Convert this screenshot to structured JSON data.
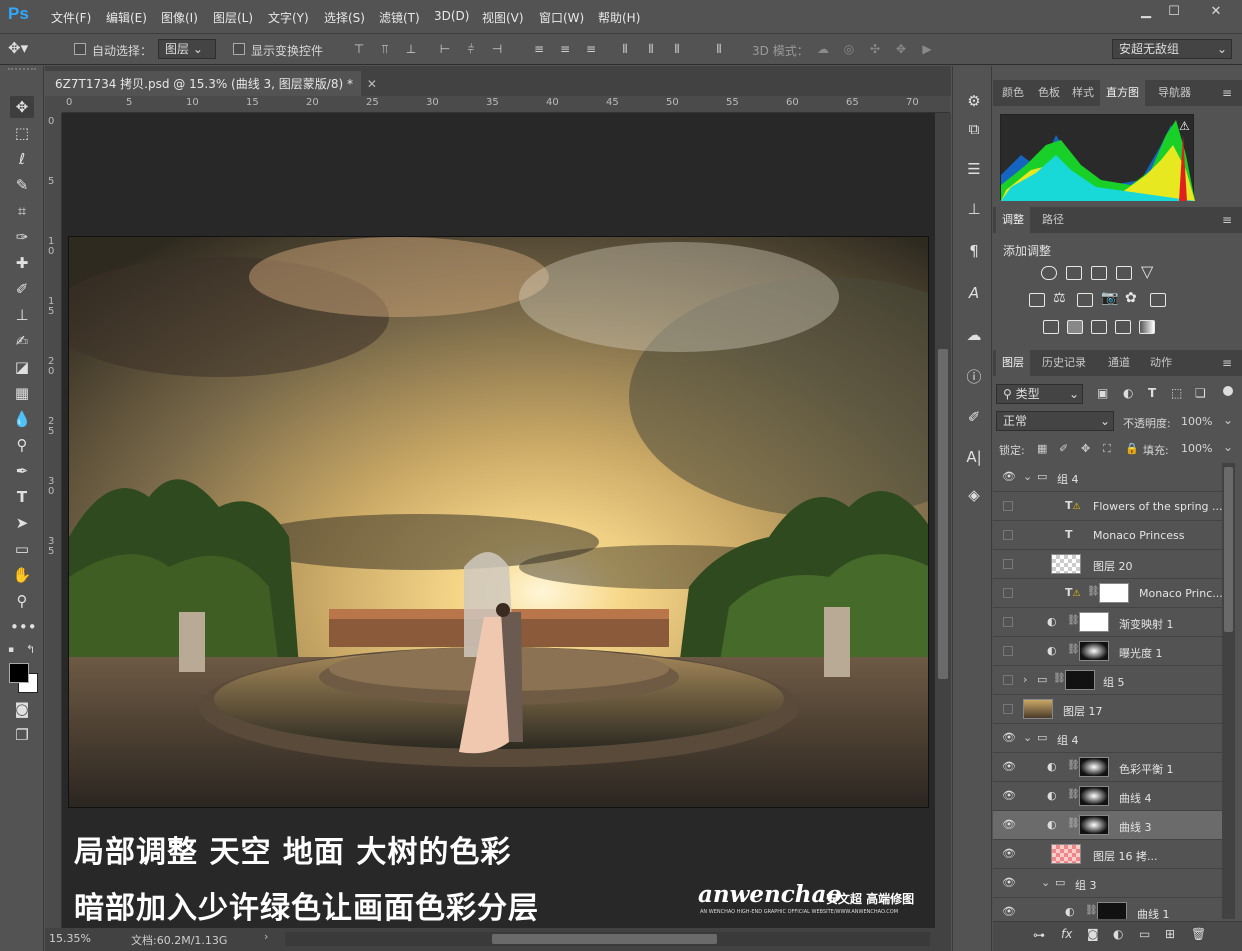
{
  "app": {
    "logo": "Ps"
  },
  "menu": [
    "文件(F)",
    "编辑(E)",
    "图像(I)",
    "图层(L)",
    "文字(Y)",
    "选择(S)",
    "滤镜(T)",
    "3D(D)",
    "视图(V)",
    "窗口(W)",
    "帮助(H)"
  ],
  "window_buttons": {
    "minimize": "▁",
    "restore": "☐",
    "close": "✕"
  },
  "options": {
    "auto_select_label": "自动选择：",
    "auto_select_value": "图层",
    "show_transform_label": "显示变换控件",
    "mode_3d_label": "3D 模式：",
    "workspace": "安超无敌组"
  },
  "document": {
    "tab_title": "6Z7T1734 拷贝.psd @ 15.3% (曲线 3, 图层蒙版/8) *",
    "ruler_h": [
      "0",
      "5",
      "10",
      "15",
      "20",
      "25",
      "30",
      "35",
      "40",
      "45",
      "50",
      "55",
      "60",
      "65",
      "70"
    ],
    "ruler_v": [
      "0",
      "5",
      "10",
      "15",
      "20",
      "25",
      "30",
      "35"
    ],
    "caption_line1": "局部调整  天空  地面  大树的色彩",
    "caption_line2": "暗部加入少许绿色让画面色彩分层",
    "watermark_main": "anwenchao",
    "watermark_cn": "安文超 高端修图",
    "watermark_sub": "AN WENCHAO HIGH-END GRAPHIC OFFICIAL WEBSITE/WWW.ANWENCHAO.COM"
  },
  "status": {
    "zoom": "15.35%",
    "doc_size": "文档:60.2M/1.13G"
  },
  "panels": {
    "top_tabs": [
      "颜色",
      "色板",
      "样式",
      "直方图",
      "导航器"
    ],
    "top_active": "直方图",
    "adj_tabs": [
      "调整",
      "路径"
    ],
    "adj_title": "添加调整",
    "layers_tabs": [
      "图层",
      "历史记录",
      "通道",
      "动作"
    ],
    "filter_kind": "类型",
    "blend_mode": "正常",
    "opacity_label": "不透明度:",
    "opacity_value": "100%",
    "lock_label": "锁定:",
    "fill_label": "填充:",
    "fill_value": "100%"
  },
  "layers": [
    {
      "name": "组 4",
      "type": "group",
      "visible": true,
      "indent": 0
    },
    {
      "name": "Flowers of the spring ...",
      "type": "text-warn",
      "visible": false,
      "indent": 1
    },
    {
      "name": "Monaco Princess",
      "type": "text",
      "visible": false,
      "indent": 1
    },
    {
      "name": "图层 20",
      "type": "checker",
      "visible": false,
      "indent": 1
    },
    {
      "name": "Monaco Princ...",
      "type": "text-mask",
      "visible": false,
      "indent": 1
    },
    {
      "name": "渐变映射 1",
      "type": "adj-white",
      "visible": false,
      "indent": 1
    },
    {
      "name": "曝光度 1",
      "type": "adj-mask",
      "visible": false,
      "indent": 1
    },
    {
      "name": "组 5",
      "type": "group-closed",
      "visible": false,
      "indent": 0
    },
    {
      "name": "图层 17",
      "type": "photo",
      "visible": false,
      "indent": 0
    },
    {
      "name": "组 4",
      "type": "group",
      "visible": true,
      "indent": 0
    },
    {
      "name": "色彩平衡 1",
      "type": "adj-mask",
      "visible": true,
      "indent": 1
    },
    {
      "name": "曲线 4",
      "type": "adj-mask",
      "visible": true,
      "indent": 1
    },
    {
      "name": "曲线 3",
      "type": "adj-mask",
      "visible": true,
      "indent": 1,
      "selected": true
    },
    {
      "name": "图层 16 拷...",
      "type": "red",
      "visible": true,
      "indent": 1
    },
    {
      "name": "组 3",
      "type": "group",
      "visible": true,
      "indent": 1
    },
    {
      "name": "曲线 1",
      "type": "adj-dark",
      "visible": true,
      "indent": 2
    }
  ],
  "colors": {
    "accent": "#31a8ff",
    "panel": "#535353",
    "dark": "#424242",
    "canvas": "#282828"
  }
}
